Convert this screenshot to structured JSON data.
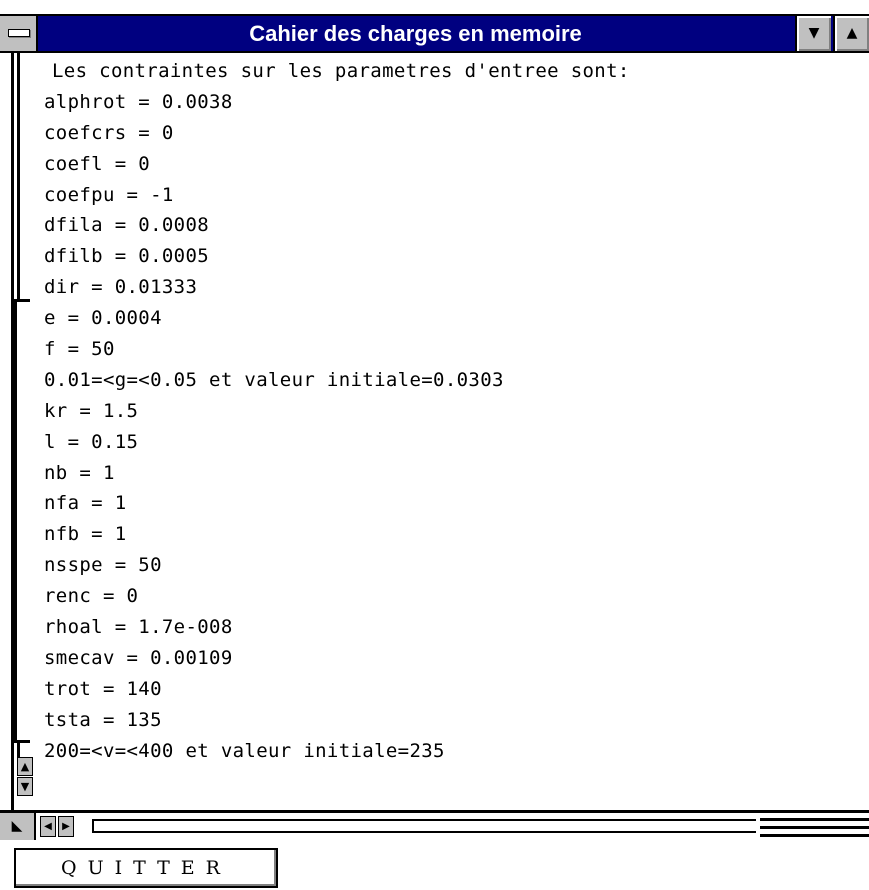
{
  "window": {
    "title": "Cahier des charges en memoire"
  },
  "icons": {
    "system_menu": "system-menu-icon",
    "minimize": "minimize-arrow-icon",
    "maximize": "maximize-arrow-icon",
    "scroll_up": "arrow-up-icon",
    "scroll_down": "arrow-down-icon",
    "scroll_left": "arrow-left-icon",
    "scroll_right": "arrow-right-icon",
    "resize": "resize-corner-icon"
  },
  "content": {
    "lines": [
      "Les contraintes sur les parametres d'entree sont:",
      "alphrot = 0.0038",
      "coefcrs = 0",
      "coefl = 0",
      "coefpu = -1",
      "dfila = 0.0008",
      "dfilb = 0.0005",
      "dir = 0.01333",
      "e = 0.0004",
      "f = 50",
      "0.01=<g=<0.05 et valeur initiale=0.0303",
      "kr = 1.5",
      "l = 0.15",
      "nb = 1",
      "nfa = 1",
      "nfb = 1",
      "nsspe = 50",
      "renc = 0",
      "rhoal = 1.7e-008",
      "smecav = 0.00109",
      "trot = 140",
      "tsta = 135",
      "200=<v=<400 et valeur initiale=235"
    ]
  },
  "footer": {
    "quit_label": "QUITTER"
  }
}
